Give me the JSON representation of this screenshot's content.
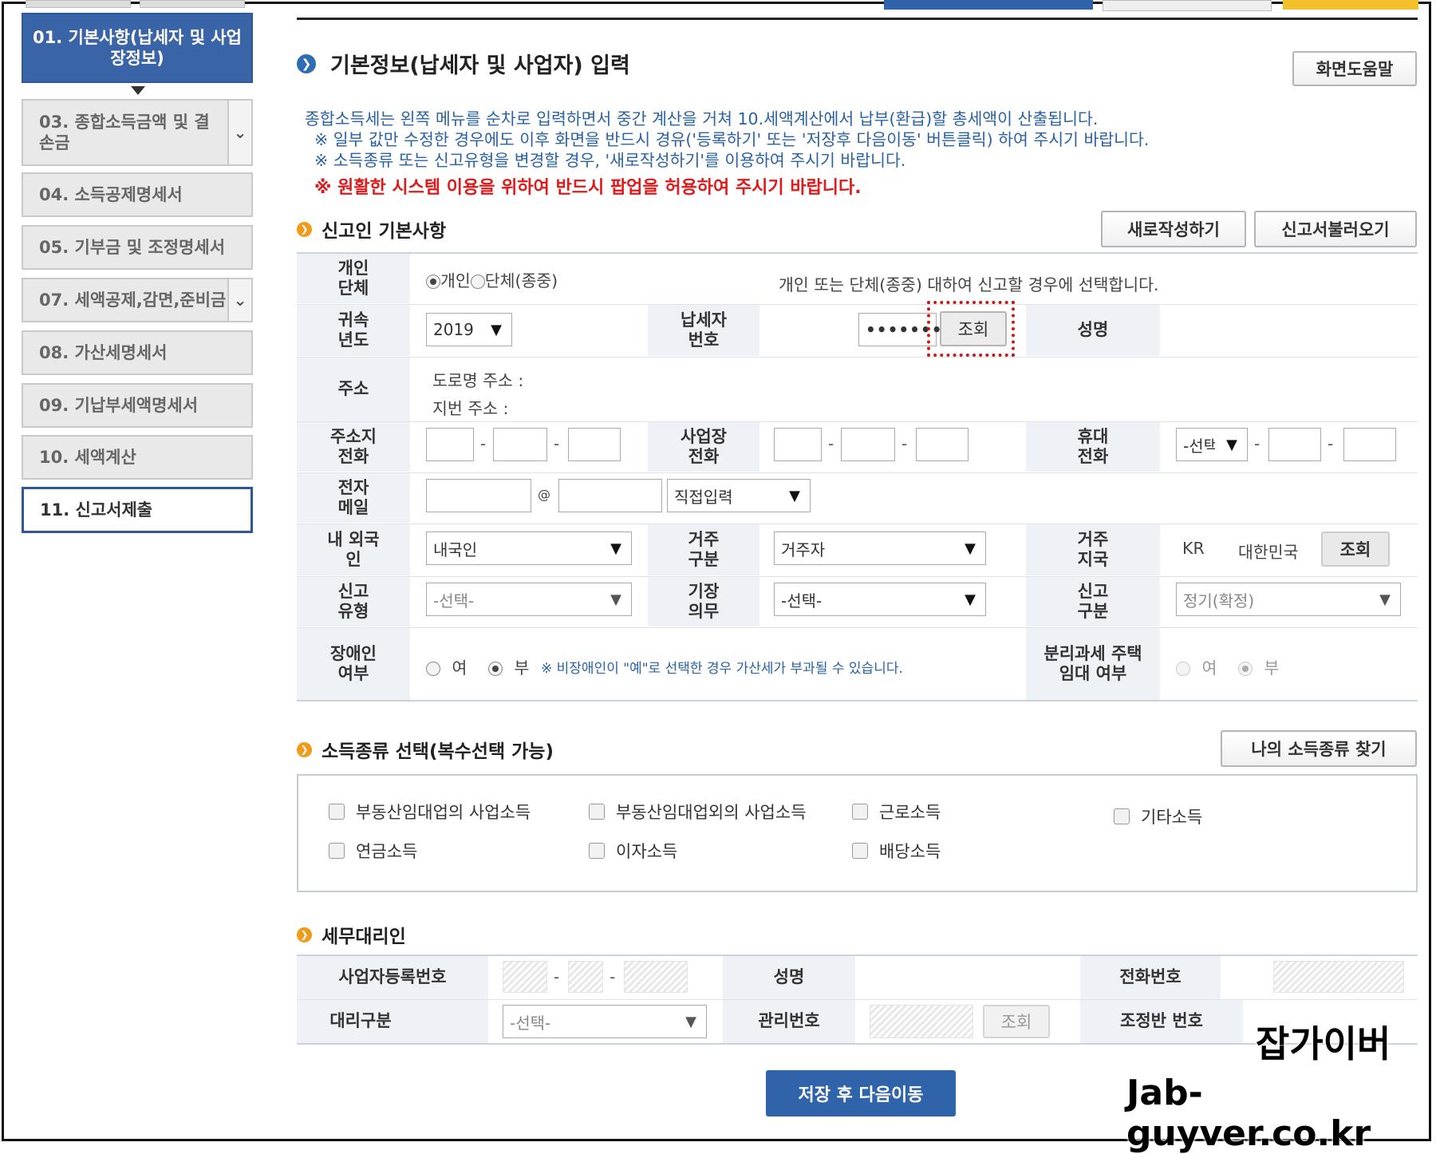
{
  "sidebar": {
    "items": [
      {
        "label": "01. 기본사항(납세자 및 사업장정보)"
      },
      {
        "label": "03. 종합소득금액 및 결손금"
      },
      {
        "label": "04. 소득공제명세서"
      },
      {
        "label": "05. 기부금 및 조정명세서"
      },
      {
        "label": "07. 세액공제,감면,준비금"
      },
      {
        "label": "08. 가산세명세서"
      },
      {
        "label": "09. 기납부세액명세서"
      },
      {
        "label": "10. 세액계산"
      },
      {
        "label": "11. 신고서제출"
      }
    ]
  },
  "header": {
    "title": "기본정보(납세자 및 사업자) 입력",
    "help_button": "화면도움말"
  },
  "notices": {
    "line1": "종합소득세는 왼쪽 메뉴를 순차로 입력하면서 중간 계산을 거쳐 10.세액계산에서 납부(환급)할 총세액이 산출됩니다.",
    "line2": "※ 일부 값만 수정한 경우에도 이후 화면을 반드시 경유('등록하기' 또는 '저장후 다음이동' 버튼클릭) 하여 주시기 바랍니다.",
    "line3": "※ 소득종류 또는 신고유형을 변경할 경우, '새로작성하기'를 이용하여 주시기 바랍니다.",
    "warning": "※ 원활한 시스템 이용을 위하여 반드시 팝업을 허용하여 주시기 바랍니다."
  },
  "basic": {
    "section_title": "신고인 기본사항",
    "new_button": "새로작성하기",
    "load_button": "신고서불러오기",
    "row1": {
      "label": "개인 단체",
      "opt_individual": "개인",
      "opt_group": "단체(종중)",
      "desc": "개인 또는 단체(종중) 대하여 신고할 경우에 선택합니다."
    },
    "row2": {
      "year_label": "귀속 년도",
      "year_value": "2019",
      "taxpayer_label": "납세자 번호",
      "taxpayer_value": "•••••••",
      "lookup_button": "조회",
      "name_label": "성명"
    },
    "row3": {
      "label": "주소",
      "road": "도로명 주소 :",
      "lot": "지번 주소 :"
    },
    "row4": {
      "home_phone_label": "주소지 전화",
      "biz_phone_label": "사업장 전화",
      "mobile_label": "휴대 전화",
      "mobile_select": "-선택-"
    },
    "row5": {
      "email_label": "전자 메일",
      "at": "@",
      "domain_select": "직접입력"
    },
    "row6": {
      "nationality_label": "내 외국인",
      "nationality_value": "내국인",
      "residence_label": "거주 구분",
      "residence_value": "거주자",
      "region_label": "거주 지국",
      "region_code": "KR",
      "region_name": "대한민국",
      "region_button": "조회"
    },
    "row7": {
      "report_type_label": "신고 유형",
      "report_type_value": "-선택-",
      "book_label": "기장 의무",
      "book_value": "-선택-",
      "report_class_label": "신고 구분",
      "report_class_value": "정기(확정)"
    },
    "row8": {
      "disabled_label": "장애인 여부",
      "yes": "여",
      "no": "부",
      "note": "※ 비장애인이 \"예\"로 선택한 경우 가산세가 부과될 수 있습니다.",
      "rental_label": "분리과세 주택임대 여부"
    }
  },
  "income": {
    "section_title": "소득종류 선택(복수선택 가능)",
    "find_button": "나의 소득종류 찾기",
    "options": [
      "부동산임대업의 사업소득",
      "부동산임대업외의 사업소득",
      "근로소득",
      "기타소득",
      "연금소득",
      "이자소득",
      "배당소득"
    ]
  },
  "agent": {
    "section_title": "세무대리인",
    "biz_no_label": "사업자등록번호",
    "name_label": "성명",
    "phone_label": "전화번호",
    "type_label": "대리구분",
    "type_value": "-선택-",
    "mgmt_label": "관리번호",
    "lookup_button": "조회",
    "team_label": "조정반 번호"
  },
  "footer": {
    "save_button": "저장 후 다음이동"
  },
  "watermark": {
    "line1": "잡가이버",
    "line2": "Jab-guyver.co.kr"
  },
  "colors": {
    "accent": "#2f64ab",
    "warning": "#e0191a",
    "notice": "#2a62a6",
    "section_dot": "#f19a1b"
  }
}
